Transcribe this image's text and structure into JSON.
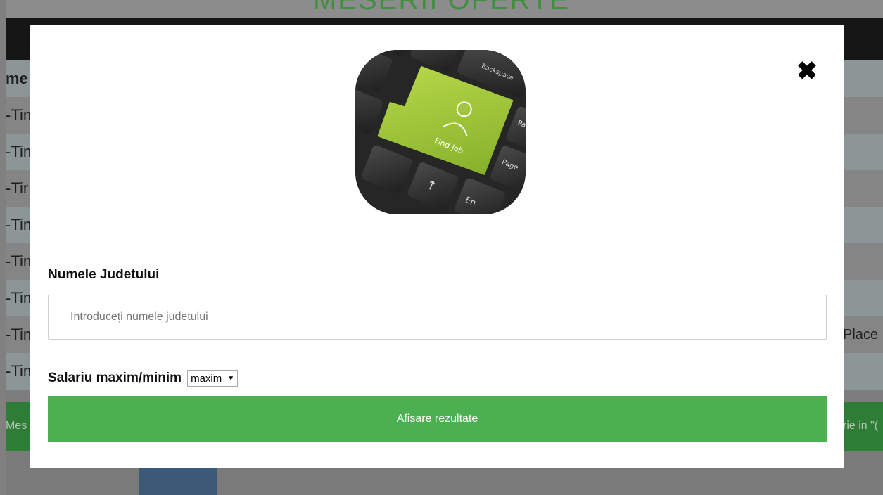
{
  "background": {
    "site_title": "MESERII OFERTE",
    "table_header": "me",
    "rows": [
      "-Tim",
      "-Tim",
      "-Tir",
      "-Tim",
      "-Tim",
      "-Tim",
      "-Tim",
      "-Tim"
    ],
    "row_right_text": "Place",
    "footer_left": "Mes",
    "footer_right": "rie in \"("
  },
  "modal": {
    "close_icon": "close-icon",
    "hero_image": {
      "key_label": "Find Job",
      "keys": [
        "Backspace",
        "Pag Up",
        "Page Down",
        "Shift",
        "En"
      ]
    },
    "county": {
      "label": "Numele Judetului",
      "placeholder": "Introduceți numele judetului",
      "value": ""
    },
    "salary": {
      "label": "Salariu maxim/minim",
      "selected": "maxim"
    },
    "submit_label": "Afisare rezultate"
  },
  "colors": {
    "accent_green": "#4caf50",
    "key_green": "#9bc53d",
    "navbar": "#161616"
  }
}
